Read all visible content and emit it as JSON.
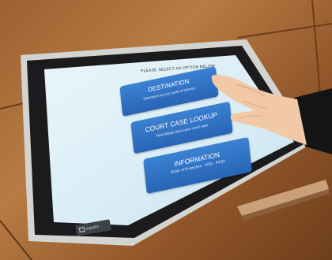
{
  "kiosk": {
    "prompt": "PLEASE SELECT AN OPTION BELOW",
    "buttons": [
      {
        "title": "DESTINATION",
        "subtitle": "Directions to your point of interest"
      },
      {
        "title": "COURT CASE LOOKUP",
        "subtitle": "Find details about your court case"
      },
      {
        "title": "INFORMATION",
        "subtitle": "Order of Protection · ADA · FAQs"
      }
    ],
    "language_button": "español",
    "colors": {
      "screen_bg": "#dff0f7",
      "button_blue": "#2f73c6",
      "bezel": "#1b1b1d",
      "frame": "#c8c8c4"
    }
  }
}
